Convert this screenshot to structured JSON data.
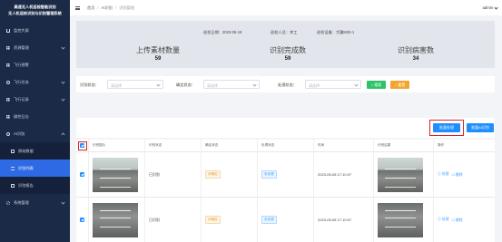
{
  "sidebar": {
    "logo_line1": "高速无人机巡检智能识别",
    "logo_line2": "无人机巡检识别与识别管理系统",
    "items": [
      {
        "label": "监控大屏",
        "icon": "home-icon"
      },
      {
        "label": "资源管理",
        "icon": "grid-icon"
      },
      {
        "label": "飞行预警",
        "icon": "grid-icon"
      },
      {
        "label": "飞行任务",
        "icon": "circle-icon"
      },
      {
        "label": "飞行记录",
        "icon": "grid-icon"
      },
      {
        "label": "操控日志",
        "icon": "grid-icon"
      },
      {
        "label": "AI识别",
        "icon": "ai-icon"
      }
    ],
    "submenu": [
      {
        "label": "原始数据"
      },
      {
        "label": "识别列表"
      },
      {
        "label": "识别报告"
      }
    ],
    "system": {
      "label": "系统管理",
      "icon": "gear-icon"
    }
  },
  "header": {
    "breadcrumb": [
      "首页",
      "AI识别",
      "识别管理"
    ],
    "user": "admin"
  },
  "stats": {
    "date_label": "巡检日期：2023-05-19",
    "inspector_label": "巡检人员：李工",
    "device_label": "巡检设备：大疆M30-1",
    "items": [
      {
        "label": "上传素材数量",
        "value": "59"
      },
      {
        "label": "识别完成数",
        "value": "59"
      },
      {
        "label": "识别病害数",
        "value": "34"
      }
    ]
  },
  "filter": {
    "status_label": "识别状态：",
    "review_label": "确定状态：",
    "handle_label": "处理状态：",
    "placeholder": "请选择",
    "search_button": "○ 搜索",
    "reset_button": "○ 重置"
  },
  "toolbar": {
    "batch_review": "批量处理",
    "batch_export": "批量AI识别"
  },
  "table": {
    "headers": [
      "识别图片",
      "识别状态",
      "确定状态",
      "处理状态",
      "时间",
      "识别结果",
      "操作"
    ],
    "rows": [
      {
        "status": "已识别",
        "review": "待确定",
        "handle": "未处理",
        "time": "2023-05-08 17:10:07",
        "op_view": "◎ 处理",
        "op_delete": "☐ 删除"
      },
      {
        "status": "已识别",
        "review": "待确定",
        "handle": "未处理",
        "time": "2023-05-08 17:10:07",
        "op_view": "◎ 处理",
        "op_delete": "☐ 删除"
      }
    ]
  },
  "colors": {
    "sidebar_bg": "#1b2a47",
    "accent": "#1f8fff",
    "search_btn": "#2fc26a",
    "reset_btn": "#f3a531",
    "highlight": "#e02020"
  }
}
